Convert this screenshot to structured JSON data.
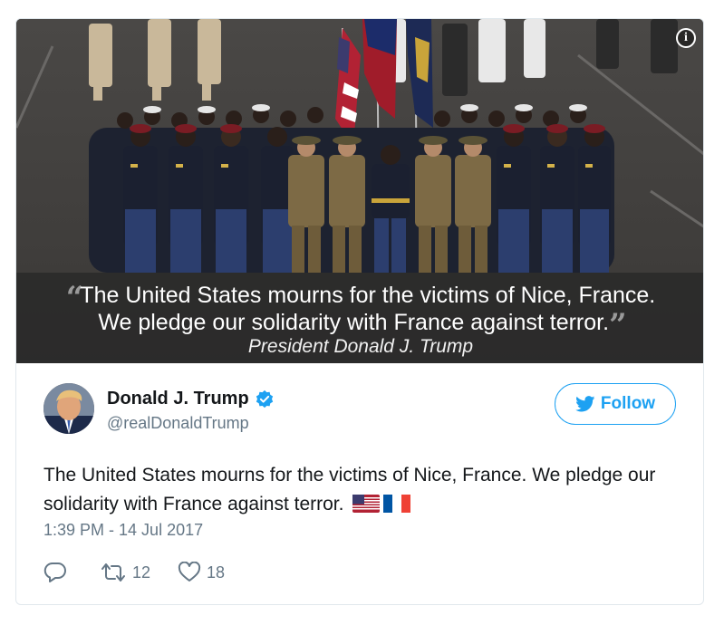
{
  "media": {
    "quote_line1": "The United States mourns for the victims of Nice, France.",
    "quote_line2": "We pledge our solidarity with France against terror.",
    "open_quote": "“",
    "close_quote": "”",
    "attribution": "President Donald J. Trump",
    "info_icon_label": "i"
  },
  "author": {
    "name": "Donald J. Trump",
    "handle": "@realDonaldTrump",
    "verified": true
  },
  "follow_button": {
    "label": "Follow"
  },
  "tweet": {
    "text": "The United States mourns for the victims of Nice, France. We pledge our solidarity with France against terror.",
    "emojis": [
      "us-flag",
      "france-flag"
    ],
    "timestamp": "1:39 PM - 14 Jul 2017"
  },
  "actions": {
    "reply_icon": "reply-icon",
    "retweet_count": "12",
    "like_count": "18"
  },
  "colors": {
    "twitter_blue": "#1da1f2",
    "text_primary": "#14171a",
    "text_secondary": "#657786",
    "border": "#e1e8ed"
  }
}
